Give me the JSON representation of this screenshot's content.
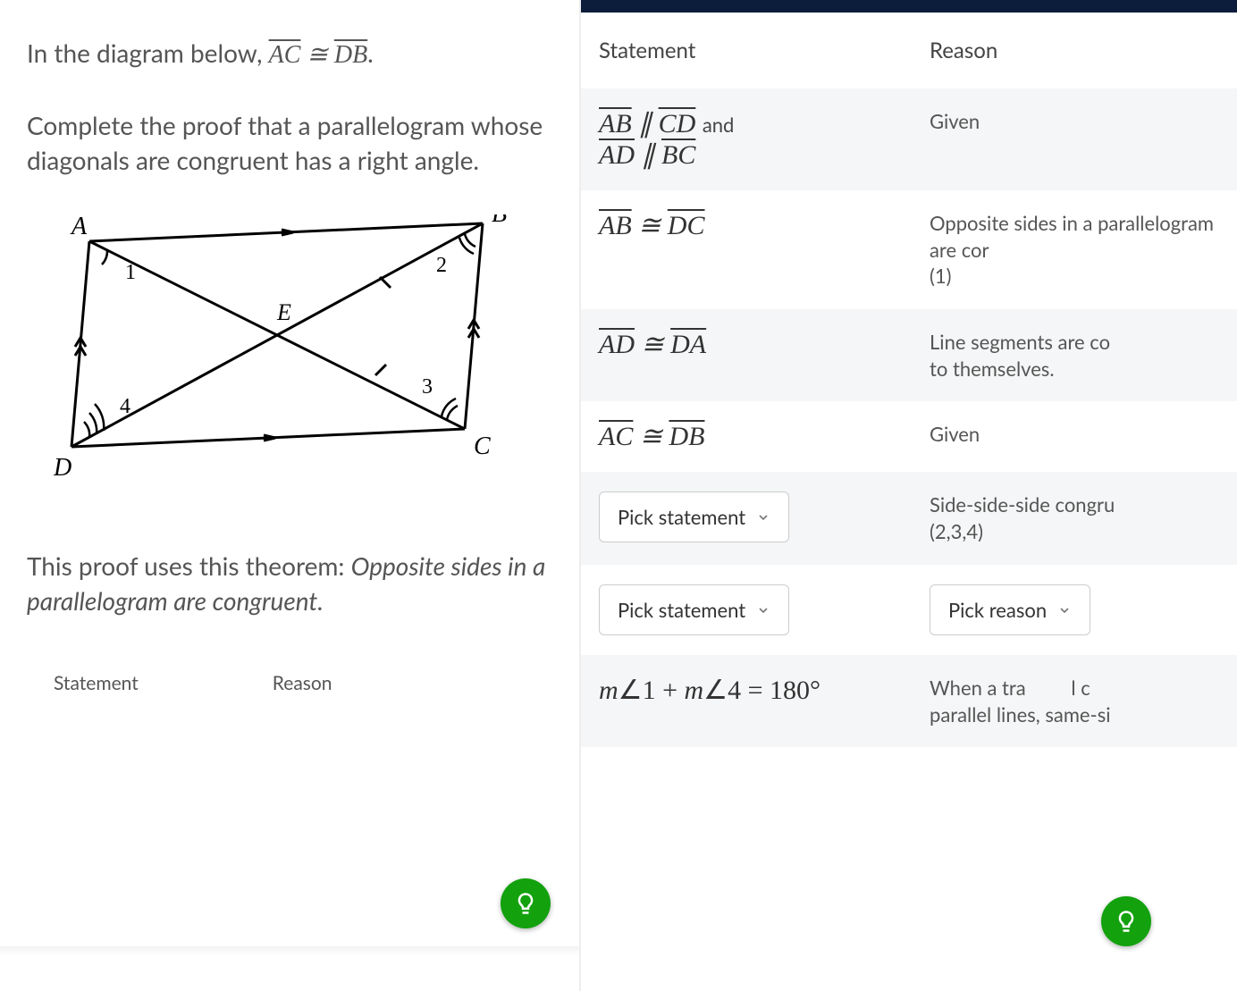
{
  "prompt": {
    "line1_pre": "In the diagram below, ",
    "seg1": "AC",
    "cong": " ≅ ",
    "seg2": "DB",
    "line1_post": ".",
    "line2": "Complete the proof that a parallelogram whose diagonals are congruent has a right angle."
  },
  "diagram": {
    "labels": {
      "A": "A",
      "B": "B",
      "C": "C",
      "D": "D",
      "E": "E"
    },
    "angles": {
      "a1": "1",
      "a2": "2",
      "a3": "3",
      "a4": "4"
    }
  },
  "theorem": {
    "pre": "This proof uses this theorem: ",
    "text": "Opposite sides in a parallelogram are congruent."
  },
  "mini_headers": {
    "statement": "Statement",
    "reason": "Reason"
  },
  "right": {
    "headers": {
      "statement": "Statement",
      "reason": "Reason"
    },
    "rows": [
      {
        "statement_parts": {
          "s1": "AB",
          "join1": " ∥ ",
          "s2": "CD",
          "small": " and",
          "s3": "AD",
          "join2": " ∥ ",
          "s4": "BC"
        },
        "reason": "Given"
      },
      {
        "statement_parts": {
          "s1": "AB",
          "join": " ≅ ",
          "s2": "DC"
        },
        "reason": "Opposite sides in a parallelogram are cor (1)"
      },
      {
        "statement_parts": {
          "s1": "AD",
          "join": " ≅ ",
          "s2": "DA"
        },
        "reason": "Line segments are co to themselves."
      },
      {
        "statement_parts": {
          "s1": "AC",
          "join": " ≅ ",
          "s2": "DB"
        },
        "reason": "Given"
      },
      {
        "picker_statement": "Pick statement",
        "reason": "Side-side-side congru (2,3,4)"
      },
      {
        "picker_statement": "Pick statement",
        "picker_reason": "Pick reason"
      },
      {
        "statement_plain": "m∠1 + m∠4 = 180°",
        "reason": "When a tra          l c parallel lines, same-si"
      }
    ]
  }
}
